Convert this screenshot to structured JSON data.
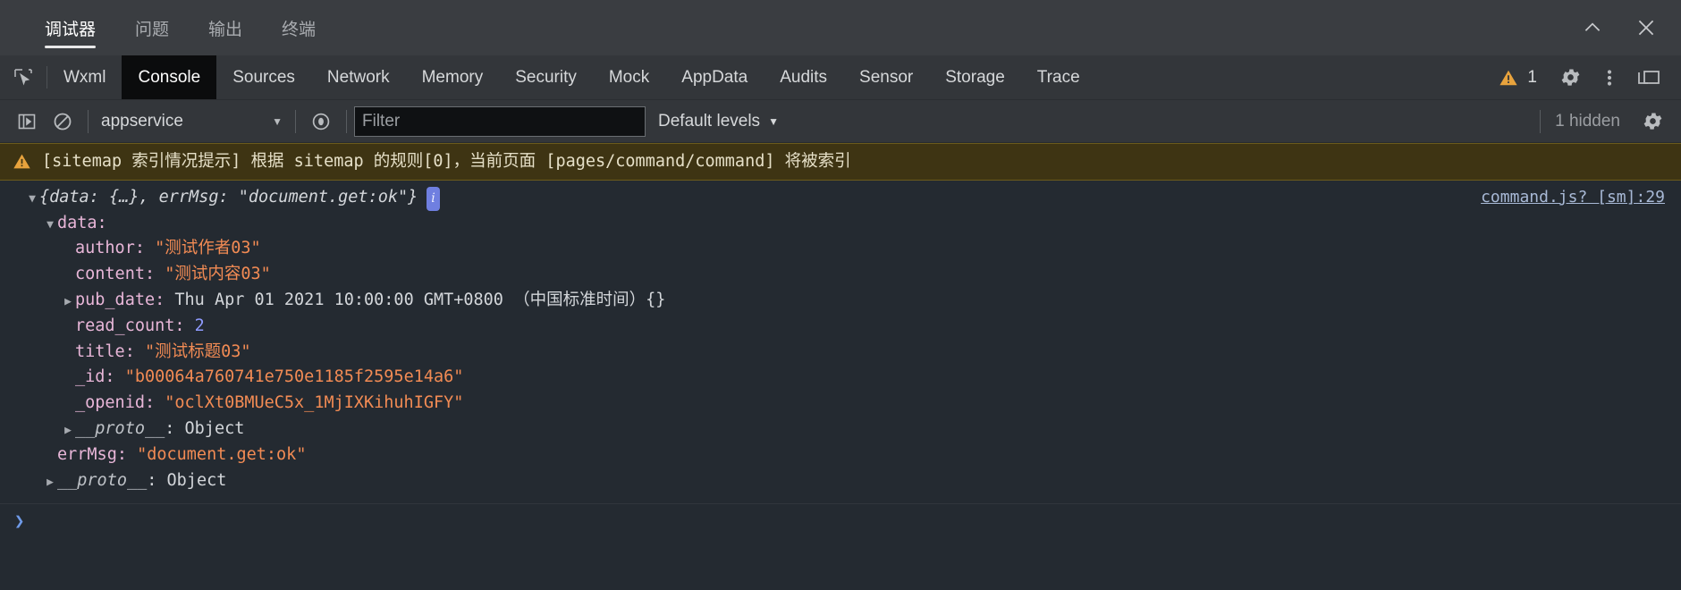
{
  "window": {
    "tabs": [
      {
        "label": "调试器",
        "active": true
      },
      {
        "label": "问题",
        "active": false
      },
      {
        "label": "输出",
        "active": false
      },
      {
        "label": "终端",
        "active": false
      }
    ],
    "minimize_icon": "chevron-up-icon",
    "close_icon": "close-icon"
  },
  "devtools": {
    "inspect_icon": "inspect-element-icon",
    "tabs": [
      "Wxml",
      "Console",
      "Sources",
      "Network",
      "Memory",
      "Security",
      "Mock",
      "AppData",
      "Audits",
      "Sensor",
      "Storage",
      "Trace"
    ],
    "active_tab": "Console",
    "warning_count": "1",
    "warning_icon": "warning-triangle-icon",
    "settings_icon": "gear-icon",
    "more_icon": "kebab-menu-icon",
    "dock_icon": "dock-panel-icon"
  },
  "filter_bar": {
    "sidebar_toggle_icon": "console-sidebar-icon",
    "clear_icon": "clear-console-icon",
    "context": "appservice",
    "context_caret": "▼",
    "eye_icon": "live-expression-icon",
    "filter_placeholder": "Filter",
    "filter_value": "",
    "levels": "Default levels",
    "levels_caret": "▼",
    "hidden_count": "1 hidden",
    "settings_icon": "gear-icon"
  },
  "console": {
    "warning_message": "[sitemap 索引情况提示] 根据 sitemap 的规则[0]，当前页面 [pages/command/command] 将被索引",
    "warning_icon": "warning-triangle-icon",
    "source_link": "command.js? [sm]:29",
    "object_preview": "{data: {…}, errMsg: \"document.get:ok\"}",
    "info_badge": "i",
    "rows": {
      "data_key": "data:",
      "author_key": "author: ",
      "author_value": "\"测试作者03\"",
      "content_key": "content: ",
      "content_value": "\"测试内容03\"",
      "pub_date_key": "pub_date: ",
      "pub_date_value": "Thu Apr 01 2021 10:00:00 GMT+0800 （中国标准时间）{}",
      "read_count_key": "read_count: ",
      "read_count_value": "2",
      "title_key": "title: ",
      "title_value": "\"测试标题03\"",
      "id_key": "_id: ",
      "id_value": "\"b00064a760741e750e1185f2595e14a6\"",
      "openid_key": "_openid: ",
      "openid_value": "\"oclXt0BMUeC5x_1MjIXKihuhIGFY\"",
      "proto_inner_key": "__proto__",
      "proto_inner_value": ": Object",
      "errmsg_key": "errMsg: ",
      "errmsg_value": "\"document.get:ok\"",
      "proto_outer_key": "__proto__",
      "proto_outer_value": ": Object"
    },
    "prompt_symbol": "❯"
  },
  "colors": {
    "accent_warning": "#e8a33d",
    "string": "#f28b54",
    "key": "#e8b6d8",
    "number": "#8f9bff",
    "link": "#a8b9d6",
    "console_bg": "#242a31",
    "warning_bg": "#3e3413"
  }
}
